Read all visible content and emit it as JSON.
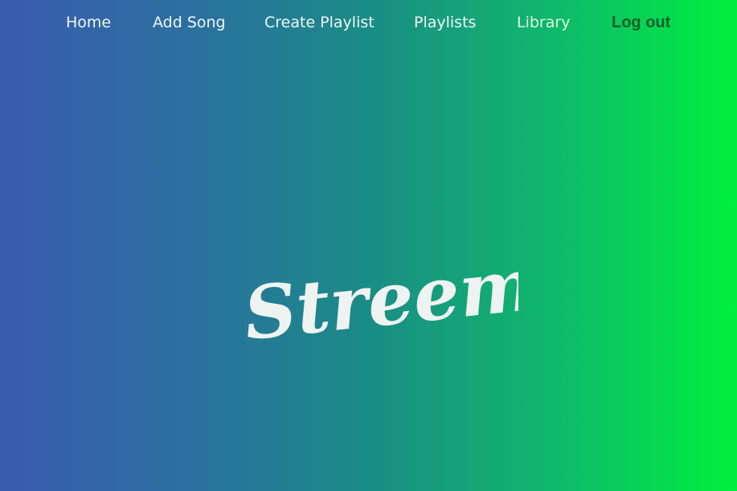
{
  "nav": {
    "items": [
      {
        "label": "Home"
      },
      {
        "label": "Add Song"
      },
      {
        "label": "Create Playlist"
      },
      {
        "label": "Playlists"
      },
      {
        "label": "Library"
      }
    ],
    "logout_label": "Log out"
  },
  "logo": {
    "text": "Streemer"
  },
  "colors": {
    "gradient_start": "#3a5bb0",
    "gradient_end": "#00f03c",
    "logout_text": "#155e2c"
  }
}
